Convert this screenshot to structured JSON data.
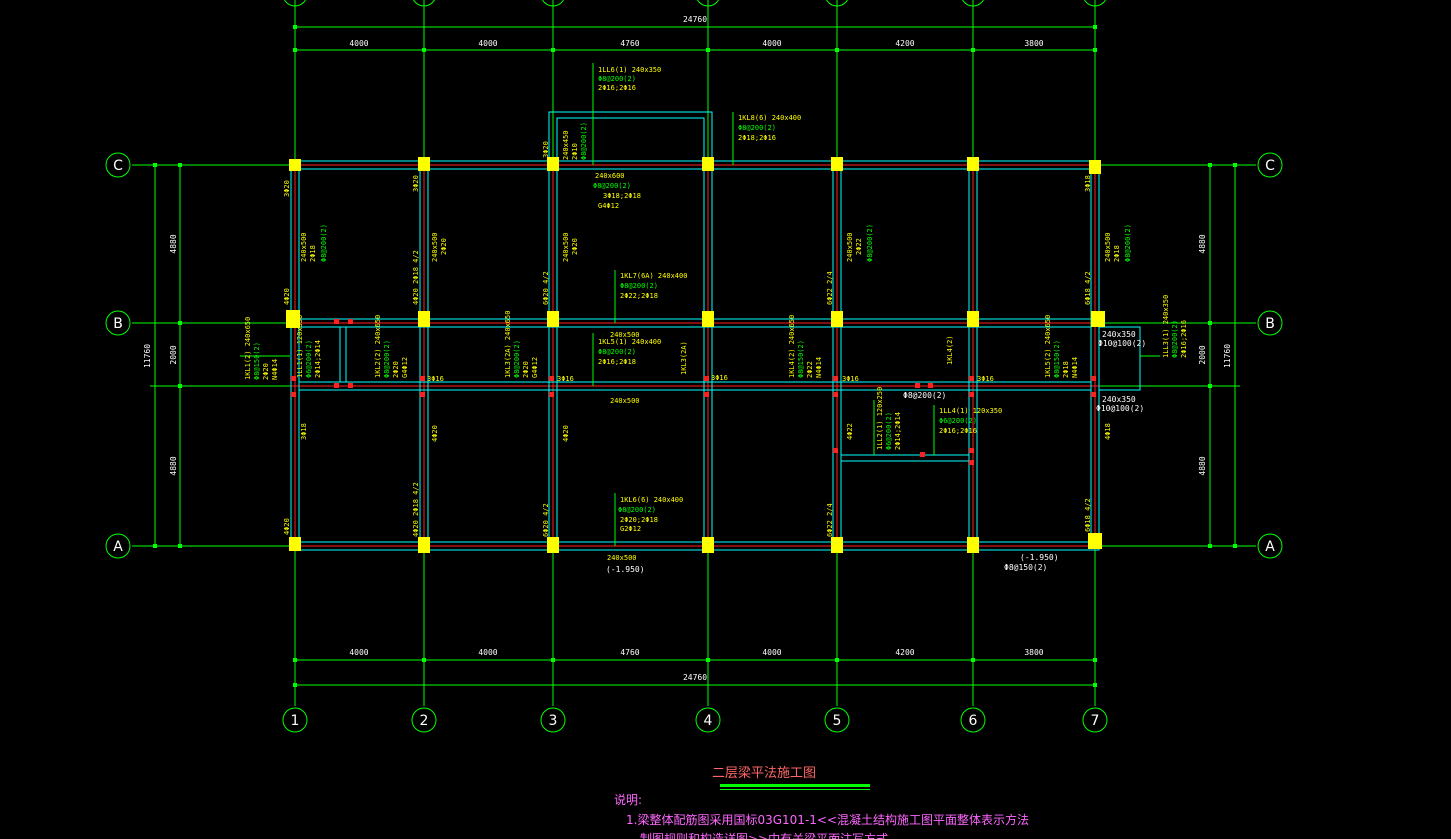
{
  "drawing": {
    "title": "二层梁平法施工图",
    "notes_heading": "说明:",
    "notes": [
      "1.梁整体配筋图采用国标03G101-1<<混凝土结构施工图平面整体表示方法",
      "制图规则和构造详图>>中有关梁平面注写方式"
    ]
  },
  "grid": {
    "columns": [
      "1",
      "2",
      "3",
      "4",
      "5",
      "6",
      "7"
    ],
    "rows": [
      "A",
      "B",
      "C"
    ]
  },
  "dimensions": {
    "top_total": "24760",
    "top_spans": [
      "4000",
      "4000",
      "4760",
      "4000",
      "4200",
      "3800"
    ],
    "bottom_total": "24760",
    "bottom_spans": [
      "4000",
      "4000",
      "4760",
      "4000",
      "4200",
      "3800"
    ],
    "left_total": "11760",
    "left_spans": [
      "4880",
      "2000",
      "4880"
    ],
    "right_total": "11760",
    "right_spans": [
      "4880",
      "2000",
      "4880"
    ]
  },
  "beam_labels": {
    "lz_a": "1LL6(1) 240x350",
    "lz_a_stirrup": "Φ8@200(2)",
    "lz_a_bars": "2Φ16;2Φ16",
    "kl8_a": "1KL8(6) 240x400",
    "kl8_a_stirrup": "Φ8@200(2)",
    "kl8_a_bars": "2Φ18;2Φ16",
    "kl7_a": "1KL7(6A) 240x400",
    "kl7_a_stirrup": "Φ8@200(2)",
    "kl7_a_bars": "2Φ22;2Φ18",
    "span_240x600": "240x600",
    "span_240x600_stirrup": "Φ8@200(2)",
    "span_240x600_bars": "3Φ18;2Φ18",
    "span_240x600_extra": "G4Φ12",
    "kl5": "1KL5(1) 240x400",
    "kl5_stirrup": "Φ8@200(2)",
    "kl5_bars": "2Φ16;2Φ18",
    "span_240x500_mid": "240x500",
    "span_240x500_lower": "240x500",
    "kl6_a": "1KL6(6) 240x400",
    "kl6_a_stirrup": "Φ8@200(2)",
    "kl6_a_bars": "2Φ20;2Φ18",
    "kl6_a_extra": "G2Φ12",
    "span_240x500_bottom": "240x500",
    "elev_bottom_left": "(-1.950)",
    "elev_bottom_right": "(-1.950)",
    "stirrup_bottom_right": "Φ8@150(2)",
    "ll4": "1LL4(1) 120x350",
    "ll4_stirrup": "Φ6@200(2)",
    "ll4_bars": "2Φ16;2Φ16",
    "ll2": "1LL2(1) 120x250",
    "ll2_stirrup": "Φ6@200(2)",
    "ll2_bars": "2Φ14;2Φ14",
    "stirrup_mid_right": "Φ8@200(2)",
    "ll3": "1LL3(1) 240x350",
    "ll3_stirrup": "Φ8@200(2)",
    "ll3_bars": "2Φ16;2Φ16",
    "r_240x350_a": "240x350",
    "r_240x350_a_stirrup": "Φ10@100(2)",
    "r_240x350_b": "240x350",
    "r_240x350_b_stirrup": "Φ10@100(2)",
    "kl1": "1KL1(2) 240x650",
    "kl1_stirrup": "Φ8@150(2)",
    "kl1_bars": "2Φ20",
    "kl1_extra": "N4Φ14",
    "ll1": "1LL1(1) 120x350",
    "ll1_stirrup": "Φ6@200(2)",
    "ll1_bars": "2Φ14;2Φ14",
    "kl2": "1KL2(2) 240x650",
    "kl2_stirrup": "Φ8@200(2)",
    "kl2_bars": "2Φ20",
    "kl2_extra": "G4Φ12",
    "kl3": "1KL3(2A) 240x650",
    "kl3_stirrup": "Φ8@200(2)",
    "kl3_bars": "2Φ20",
    "kl3_extra": "G4Φ12",
    "kl32": "1KL3(2A)",
    "kl4": "1KL4(2) 240x650",
    "kl4_stirrup": "Φ8@150(2)",
    "kl4_bars": "2Φ22",
    "kl4_extra": "N4Φ14",
    "kl42": "1KL4(2)",
    "kl5b": "1KL5(2) 240x650",
    "kl5b_stirrup": "Φ8@150(2)",
    "kl5b_bars": "2Φ18",
    "kl5b_extra": "N4Φ14",
    "v_240x500_1": "240x500",
    "v_240x500_1_bars": "2Φ18",
    "v_240x500_1_stirrup": "Φ8@200(2)",
    "v_240x500_2": "240x500",
    "v_240x500_2_bars": "2Φ20",
    "v_240x500_3": "240x500",
    "v_240x500_3_bars": "2Φ20",
    "v_240x500_5": "240x500",
    "v_240x500_5_bars": "2Φ22",
    "v_240x500_5_stirrup": "Φ8@200(2)",
    "v_240x500_7": "240x500",
    "v_240x500_7_bars": "2Φ18",
    "v_240x500_7_stirrup": "Φ8@200(2)",
    "b_3q16_1": "3Φ16",
    "b_3q16_2": "3Φ16",
    "b_3q16_3": "3Φ16",
    "b_3q16_4": "3Φ16",
    "b_3q16_5": "3Φ16",
    "v_3q20_1": "3Φ20",
    "v_3q20_2": "3Φ20",
    "v_3q18_7": "3Φ18",
    "v_3q18_1b": "3Φ18",
    "v_4q20_2b": "4Φ20",
    "v_4q20_3b": "4Φ20",
    "v_4q22_5b": "4Φ22",
    "v_4q18_7b": "4Φ18",
    "v_4q20_1a": "4Φ20",
    "v_4q20_1b": "4Φ20",
    "v_6q18_7a": "6Φ18 4/2",
    "v_6q18_7b": "6Φ18 4/2",
    "v_6q20_3a": "6Φ20 4/2",
    "v_6q20_3b": "6Φ20 4/2",
    "v_6q22_5a": "6Φ22 2/4",
    "v_6q22_5b": "6Φ22 2/4",
    "v_4q20_2a": "4Φ20 2Φ18 4/2",
    "v_4q20_2c": "4Φ20 2Φ18 4/2",
    "v_top3": "2Φ10",
    "v_top3b": "Φ8@200(2)",
    "v_top3c": "240x450",
    "v_top3d": "3Φ20"
  },
  "colors": {
    "background": "#000000",
    "grid_line": "#00ff00",
    "wall_outline": "#00ffff",
    "column": "#ffff00",
    "axis_red": "#ff2020",
    "text_white": "#ffffff",
    "text_yellow": "#ffff00",
    "text_green": "#00ff00",
    "title_red": "#ff6666",
    "note_magenta": "#ff66ff"
  }
}
